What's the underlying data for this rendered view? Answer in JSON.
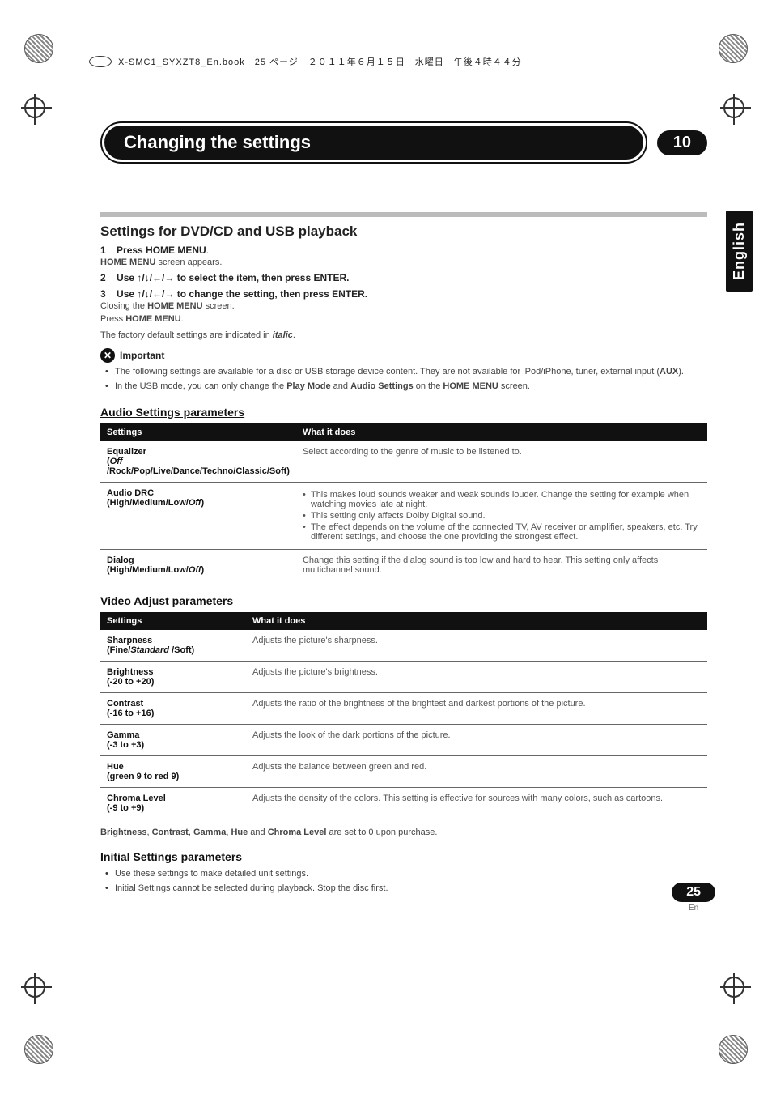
{
  "header": {
    "book_line": "X-SMC1_SYXZT8_En.book　25 ページ　２０１１年６月１５日　水曜日　午後４時４４分"
  },
  "title": {
    "chapter_title": "Changing the settings",
    "chapter_number": "10",
    "side_tab": "English"
  },
  "section1": {
    "heading": "Settings for DVD/CD and USB playback",
    "step1_num": "1",
    "step1_bold": "Press HOME MENU",
    "step1_tail": ".",
    "step1_sub_pre": "HOME MENU",
    "step1_sub_post": " screen appears.",
    "step2_num": "2",
    "step2_text_pre": "Use ",
    "step2_arrows": "↑/↓/←/→",
    "step2_text_mid": " to select the item, then press ",
    "step2_enter": "ENTER",
    "step2_tail": ".",
    "step3_num": "3",
    "step3_text_pre": "Use ",
    "step3_arrows": "↑/↓/←/→",
    "step3_text_mid": " to change the setting, then press ",
    "step3_enter": "ENTER",
    "step3_tail": ".",
    "step3_sub1_pre": "Closing the ",
    "step3_sub1_bold": "HOME MENU",
    "step3_sub1_post": " screen.",
    "step3_sub2_pre": "Press ",
    "step3_sub2_bold": "HOME MENU",
    "step3_sub2_post": ".",
    "factory_note_pre": "The factory default settings are indicated in ",
    "factory_note_italic": "italic",
    "factory_note_post": ".",
    "important_label": "Important",
    "important_b1_pre": "The following settings are available for a disc or USB storage device content. They are not available for iPod/iPhone, tuner, external input (",
    "important_b1_bold": "AUX",
    "important_b1_post": ").",
    "important_b2_pre": "In the USB mode, you can only change the ",
    "important_b2_b1": "Play Mode",
    "important_b2_mid": " and ",
    "important_b2_b2": "Audio Settings",
    "important_b2_mid2": " on the ",
    "important_b2_b3": "HOME MENU",
    "important_b2_post": " screen."
  },
  "audio_table": {
    "heading": "Audio Settings parameters",
    "col1": "Settings",
    "col2": "What it does",
    "rows": [
      {
        "name": "Equalizer",
        "sub_pre": "(",
        "sub_italic": "Off",
        "sub_post": " /Rock/Pop/Live/Dance/Techno/Classic/Soft)",
        "desc": "Select according to the genre of music to be listened to."
      },
      {
        "name": "Audio DRC",
        "sub_pre": "(High/Medium/Low/",
        "sub_italic": "Off",
        "sub_post": ")",
        "desc_b1": "This makes loud sounds weaker and weak sounds louder. Change the setting for example when watching movies late at night.",
        "desc_b2": "This setting only affects Dolby Digital sound.",
        "desc_b3": "The effect depends on the volume of the connected TV, AV receiver or amplifier, speakers, etc. Try different settings, and choose the one providing the strongest effect."
      },
      {
        "name": "Dialog",
        "sub_pre": "(High/Medium/Low/",
        "sub_italic": "Off",
        "sub_post": ")",
        "desc": "Change this setting if the dialog sound is too low and hard to hear. This setting only affects multichannel sound."
      }
    ]
  },
  "video_table": {
    "heading": "Video Adjust parameters",
    "col1": "Settings",
    "col2": "What it does",
    "rows": [
      {
        "name": "Sharpness",
        "sub_pre": "(Fine/",
        "sub_italic": "Standard",
        "sub_post": " /Soft)",
        "desc": "Adjusts the picture's sharpness."
      },
      {
        "name": "Brightness",
        "sub": "(-20 to +20)",
        "desc": "Adjusts the picture's brightness."
      },
      {
        "name": "Contrast",
        "sub": "(-16 to +16)",
        "desc": "Adjusts the ratio of the brightness of the brightest and darkest portions of the picture."
      },
      {
        "name": "Gamma",
        "sub": "(-3 to +3)",
        "desc": "Adjusts the look of the dark portions of the picture."
      },
      {
        "name": "Hue",
        "sub": "(green 9 to red 9)",
        "desc": "Adjusts the balance between green and red."
      },
      {
        "name": "Chroma Level",
        "sub": "(-9 to +9)",
        "desc": "Adjusts the density of the colors. This setting is effective for sources with many colors, such as cartoons."
      }
    ],
    "footnote_b1": "Brightness",
    "footnote_s1": ", ",
    "footnote_b2": "Contrast",
    "footnote_s2": ", ",
    "footnote_b3": "Gamma",
    "footnote_s3": ", ",
    "footnote_b4": "Hue",
    "footnote_s4": " and ",
    "footnote_b5": "Chroma Level",
    "footnote_tail": " are set to 0 upon purchase."
  },
  "initial": {
    "heading": "Initial Settings parameters",
    "b1": "Use these settings to make detailed unit settings.",
    "b2": "Initial Settings cannot be selected during playback. Stop the disc first."
  },
  "page": {
    "number": "25",
    "lang": "En"
  }
}
